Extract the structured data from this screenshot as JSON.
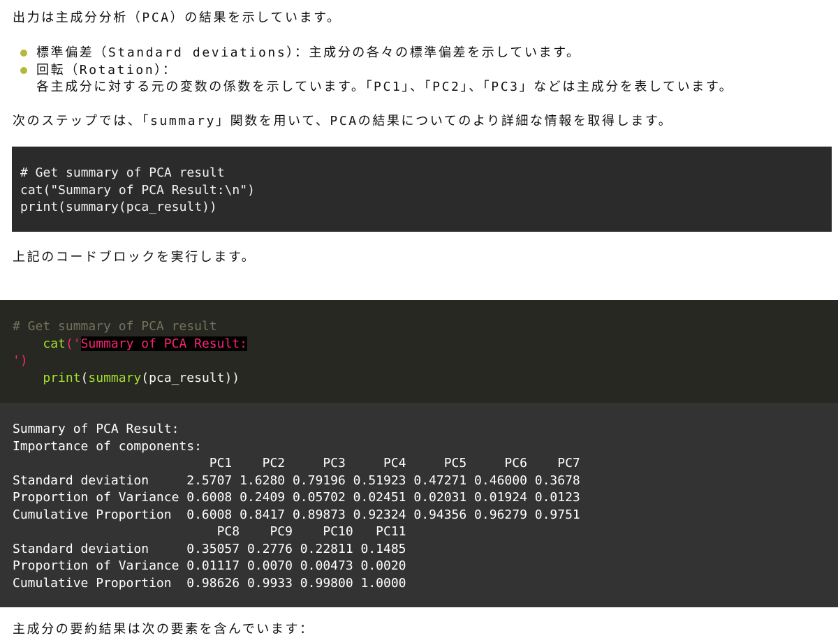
{
  "intro": "出力は主成分分析（PCA）の結果を示しています。",
  "bullets": [
    {
      "text": "標準偏差（Standard deviations）：主成分の各々の標準偏差を示しています。"
    },
    {
      "text": "回転（Rotation）：",
      "sub": "各主成分に対する元の変数の係数を示しています。「PC1」、「PC2」、「PC3」などは主成分を表しています。"
    }
  ],
  "next_step": "次のステップでは、「summary」関数を用いて、PCAの結果についてのより詳細な情報を取得します。",
  "code_block": {
    "lines": [
      "# Get summary of PCA result",
      "cat(\"Summary of PCA Result:\\n\")",
      "print(summary(pca_result))"
    ]
  },
  "run_text": "上記のコードブロックを実行します。",
  "cell_input": {
    "comment": "# Get summary of PCA result",
    "cat_indent": "    ",
    "cat_fn": "cat",
    "cat_open": "('",
    "cat_str": "Summary of PCA Result:",
    "cat_close_quote": "'",
    "cat_close_paren": ")",
    "print_indent": "    ",
    "print_fn": "print",
    "print_open": "(",
    "summary_fn": "summary",
    "print_rest": "(pca_result))"
  },
  "cell_output": {
    "lines": [
      "Summary of PCA Result:",
      "Importance of components:",
      "                          PC1    PC2     PC3     PC4     PC5     PC6    PC7",
      "Standard deviation     2.5707 1.6280 0.79196 0.51923 0.47271 0.46000 0.3678",
      "Proportion of Variance 0.6008 0.2409 0.05702 0.02451 0.02031 0.01924 0.0123",
      "Cumulative Proportion  0.6008 0.8417 0.89873 0.92324 0.94356 0.96279 0.9751",
      "                           PC8    PC9    PC10   PC11",
      "Standard deviation     0.35057 0.2776 0.22811 0.1485",
      "Proportion of Variance 0.01117 0.0070 0.00473 0.0020",
      "Cumulative Proportion  0.98626 0.9933 0.99800 1.0000"
    ]
  },
  "footer_text": "主成分の要約結果は次の要素を含んでいます：",
  "colors": {
    "bullet": "#b5b83a",
    "code_bg": "#2b2b2b",
    "input_bg": "#272822",
    "output_bg": "#333333",
    "comment": "#75715e",
    "function": "#a6e22e",
    "string": "#f92672"
  }
}
